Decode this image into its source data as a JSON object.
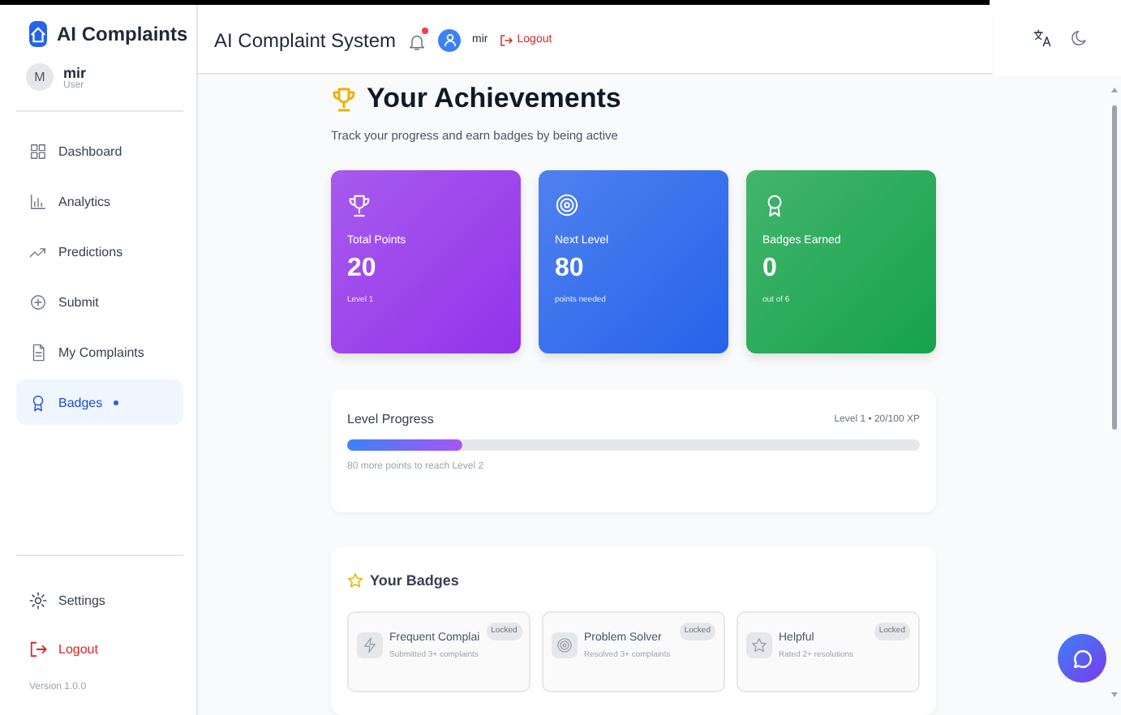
{
  "sidebar": {
    "logo": "AI Complaints",
    "user": {
      "initial": "M",
      "name": "mir",
      "role": "User"
    },
    "items": [
      {
        "label": "Dashboard",
        "selected": false
      },
      {
        "label": "Analytics",
        "selected": false
      },
      {
        "label": "Predictions",
        "selected": false
      },
      {
        "label": "Submit",
        "selected": false
      },
      {
        "label": "My Complaints",
        "selected": false
      },
      {
        "label": "Badges",
        "selected": true
      }
    ],
    "settings": "Settings",
    "logout": "Logout",
    "version": "Version 1.0.0"
  },
  "header": {
    "title": "AI Complaint System",
    "notification": true,
    "user": "mir",
    "logout": "Logout"
  },
  "page": {
    "title": "Your Achievements",
    "subtitle": "Track your progress and earn badges by being active",
    "stats": [
      {
        "label": "Total Points",
        "value": "20",
        "note": "Level 1",
        "color": "#9333ea"
      },
      {
        "label": "Next Level",
        "value": "80",
        "note": "points needed",
        "color": "#2563eb"
      },
      {
        "label": "Badges Earned",
        "value": "0",
        "note": "out of 6",
        "color": "#16a34a"
      }
    ],
    "progress": {
      "title": "Level Progress",
      "reading": "Level 1 • 20/100 XP",
      "level": 0.2,
      "note": "80 more points to reach Level 2"
    },
    "badges": {
      "title": "Your Badges",
      "items": [
        {
          "name": "Frequent Complai",
          "description": "Submitted 3+ complaints",
          "status": "Locked"
        },
        {
          "name": "Problem Solver",
          "description": "Resolved 3+ complaints",
          "status": "Locked"
        },
        {
          "name": "Helpful",
          "description": "Rated 2+ resolutions",
          "status": "Locked"
        }
      ]
    }
  }
}
